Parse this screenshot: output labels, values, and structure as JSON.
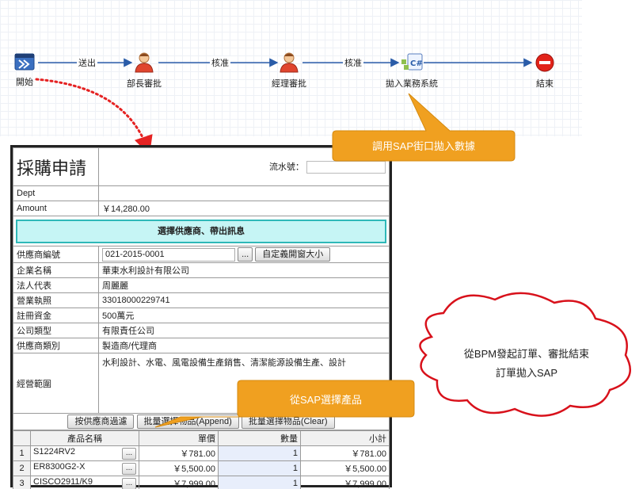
{
  "workflow": {
    "nodes": [
      {
        "label": "開始",
        "icon": "start-flag-icon"
      },
      {
        "label": "部長審批",
        "icon": "user-approver-icon"
      },
      {
        "label": "經理審批",
        "icon": "user-approver-icon"
      },
      {
        "label": "拋入業務系統",
        "icon": "csharp-script-icon"
      },
      {
        "label": "結束",
        "icon": "stop-icon"
      }
    ],
    "edges": [
      "送出",
      "核准",
      "核准"
    ]
  },
  "callouts": {
    "sap_call": "調用SAP街口拋入數據",
    "sap_select": "從SAP選擇產品",
    "cloud_line1": "從BPM發起訂單、審批結束",
    "cloud_line2": "訂單拋入SAP"
  },
  "form": {
    "title": "採購申請",
    "serial_label": "流水號：",
    "serial_value": "",
    "dept_label": "Dept",
    "dept_value": "",
    "amount_label": "Amount",
    "amount_value": "￥14,280.00",
    "vendor_section": "選擇供應商、帶出訊息",
    "vendor_no_label": "供應商編號",
    "vendor_no_value": "021-2015-0001",
    "pick_btn": "...",
    "custom_size_btn": "自定義開窗大小",
    "company_label": "企業名稱",
    "company_value": "華東水利設計有限公司",
    "legal_label": "法人代表",
    "legal_value": "周麗麗",
    "license_label": "營業執照",
    "license_value": "33018000229741",
    "capital_label": "註冊資金",
    "capital_value": "500萬元",
    "type_label": "公司類型",
    "type_value": "有限責任公司",
    "category_label": "供應商類別",
    "category_value": "製造商/代理商",
    "scope_label": "經營範圍",
    "scope_value": "水利設計、水電、風電設備生產銷售、清潔能源設備生產、設計",
    "btn_filter": "按供應商過濾",
    "btn_append": "批量選擇物品(Append)",
    "btn_clear": "批量選擇物品(Clear)"
  },
  "items": {
    "headers": [
      "產品名稱",
      "單價",
      "數量",
      "小計"
    ],
    "rows": [
      {
        "idx": "1",
        "name": "S1224RV2",
        "price": "￥781.00",
        "qty": "1",
        "subtotal": "￥781.00"
      },
      {
        "idx": "2",
        "name": "ER8300G2-X",
        "price": "￥5,500.00",
        "qty": "1",
        "subtotal": "￥5,500.00"
      },
      {
        "idx": "3",
        "name": "CISCO2911/K9",
        "price": "￥7,999.00",
        "qty": "1",
        "subtotal": "￥7,999.00"
      }
    ]
  },
  "colors": {
    "callout_orange": "#f0a020",
    "cloud_border": "#d8111b",
    "bar_fill": "#c6f5f5",
    "arrow_dots": "#e52222"
  }
}
